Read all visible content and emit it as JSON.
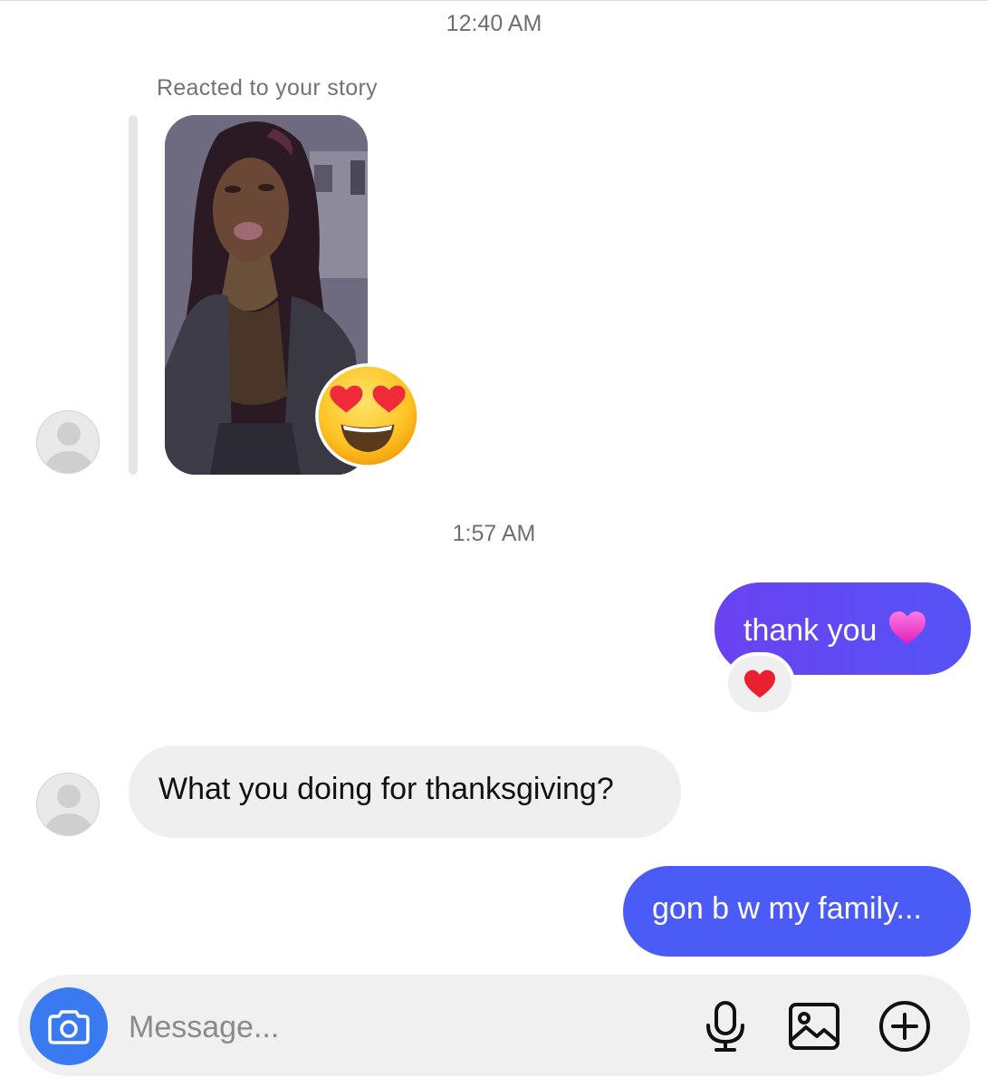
{
  "thread": {
    "timestamp_1": "12:40 AM",
    "story_reply_label": "Reacted to your story",
    "story_reaction_emoji": "heart-eyes",
    "timestamp_2": "1:57 AM"
  },
  "messages": [
    {
      "direction": "outgoing",
      "text": "thank you",
      "trailing_emoji": "pink-heart",
      "reaction": "red-heart"
    },
    {
      "direction": "incoming",
      "text": "What you doing for thanksgiving?"
    },
    {
      "direction": "outgoing",
      "text": "gon b w my family..."
    }
  ],
  "composer": {
    "placeholder": "Message...",
    "icons": [
      "camera-icon",
      "microphone-icon",
      "gallery-icon",
      "plus-icon"
    ]
  },
  "colors": {
    "outgoing_bubble": "#5653f6",
    "incoming_bubble": "#efefef",
    "camera_button": "#3a7af0"
  }
}
